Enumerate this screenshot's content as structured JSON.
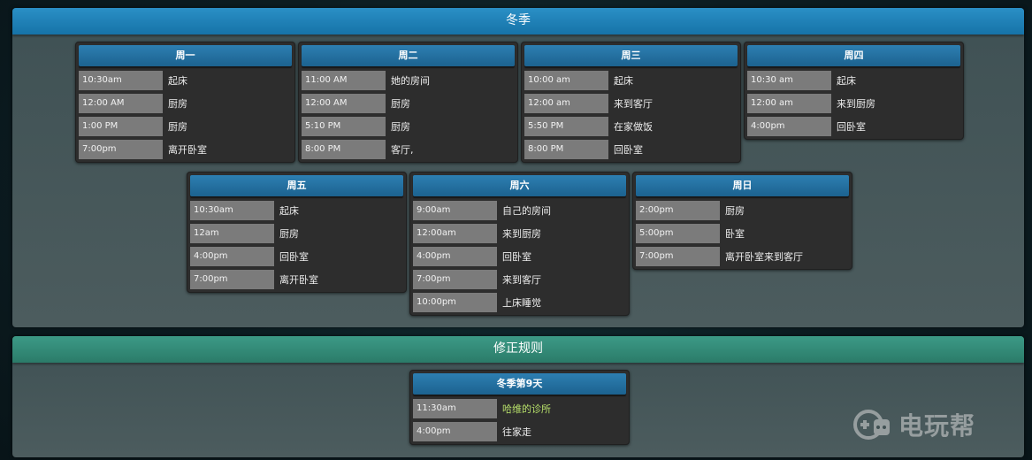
{
  "winter": {
    "title": "冬季",
    "days": [
      {
        "name": "周一",
        "rows": [
          {
            "time": "10:30am",
            "activity": "起床"
          },
          {
            "time": "12:00 AM",
            "activity": "厨房"
          },
          {
            "time": "1:00 PM",
            "activity": "厨房"
          },
          {
            "time": "7:00pm",
            "activity": "离开卧室"
          }
        ]
      },
      {
        "name": "周二",
        "rows": [
          {
            "time": "11:00 AM",
            "activity": "她的房间"
          },
          {
            "time": "12:00 AM",
            "activity": "厨房"
          },
          {
            "time": "5:10 PM",
            "activity": "厨房"
          },
          {
            "time": "8:00 PM",
            "activity": "客厅,"
          }
        ]
      },
      {
        "name": "周三",
        "rows": [
          {
            "time": "10:00 am",
            "activity": "起床"
          },
          {
            "time": "12:00 am",
            "activity": "来到客厅"
          },
          {
            "time": "5:50 PM",
            "activity": "在家做饭"
          },
          {
            "time": "8:00 PM",
            "activity": "回卧室"
          }
        ]
      },
      {
        "name": "周四",
        "rows": [
          {
            "time": "10:30 am",
            "activity": "起床"
          },
          {
            "time": "12:00 am",
            "activity": "来到厨房"
          },
          {
            "time": "4:00pm",
            "activity": "回卧室"
          }
        ]
      },
      {
        "name": "周五",
        "rows": [
          {
            "time": "10:30am",
            "activity": "起床"
          },
          {
            "time": "12am",
            "activity": "厨房"
          },
          {
            "time": "4:00pm",
            "activity": "回卧室"
          },
          {
            "time": "7:00pm",
            "activity": "离开卧室"
          }
        ]
      },
      {
        "name": "周六",
        "rows": [
          {
            "time": "9:00am",
            "activity": "自己的房间"
          },
          {
            "time": "12:00am",
            "activity": "来到厨房"
          },
          {
            "time": "4:00pm",
            "activity": "回卧室"
          },
          {
            "time": "7:00pm",
            "activity": "来到客厅"
          },
          {
            "time": "10:00pm",
            "activity": "上床睡觉"
          }
        ]
      },
      {
        "name": "周日",
        "rows": [
          {
            "time": "2:00pm",
            "activity": "厨房"
          },
          {
            "time": "5:00pm",
            "activity": "卧室"
          },
          {
            "time": "7:00pm",
            "activity": "离开卧室来到客厅"
          }
        ]
      }
    ]
  },
  "rules": {
    "title": "修正规则",
    "card": {
      "name": "冬季第9天",
      "rows": [
        {
          "time": "11:30am",
          "activity": "哈维的诊所",
          "highlight": true
        },
        {
          "time": "4:00pm",
          "activity": "往家走"
        }
      ]
    }
  },
  "watermark": {
    "text": "电玩帮",
    "icon": "gamepad-icon"
  },
  "colors": {
    "winter_header": "#1673a8",
    "rules_header": "#2b7b69",
    "card_header": "#1c628f",
    "highlight_text": "#b7e06a"
  }
}
